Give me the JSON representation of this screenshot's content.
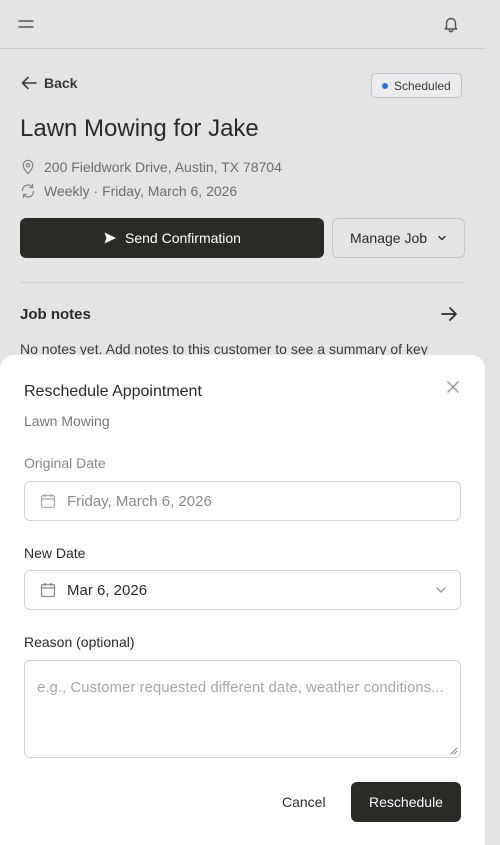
{
  "header": {
    "menu_icon": "hamburger-icon",
    "bell_icon": "bell-icon"
  },
  "job": {
    "back_label": "Back",
    "status": "Scheduled",
    "status_color": "#2f6fde",
    "title": "Lawn Mowing for Jake",
    "address": "200 Fieldwork Drive, Austin, TX 78704",
    "frequency": "Weekly · Friday, March 6, 2026",
    "send_confirmation_label": "Send Confirmation",
    "manage_job_label": "Manage Job",
    "notes_title": "Job notes",
    "notes_text": "No notes yet. Add notes to this customer to see a summary of key"
  },
  "modal": {
    "title": "Reschedule Appointment",
    "subtitle": "Lawn Mowing",
    "original_date_label": "Original Date",
    "original_date_value": "Friday, March 6, 2026",
    "new_date_label": "New Date",
    "new_date_value": "Mar 6, 2026",
    "reason_label": "Reason (optional)",
    "reason_placeholder": "e.g., Customer requested different date, weather conditions...",
    "cancel_label": "Cancel",
    "reschedule_label": "Reschedule"
  },
  "colors": {
    "primary_button": "#2b2a27",
    "background": "#e4e4e4"
  }
}
